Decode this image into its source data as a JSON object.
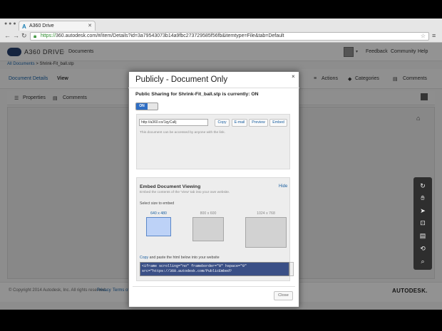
{
  "browser": {
    "tab_title": "A360 Drive",
    "tab_icon": "autodesk-a",
    "url_scheme": "https://",
    "url_rest": "360.autodesk.com/#/item/Details?id=3a79543073b14a9fbc273729585f56fb&itemtype=File&tab=Default"
  },
  "app": {
    "brand": "A360 DRIVE",
    "section": "Documents",
    "feedback": "Feedback",
    "community": "Community",
    "help": "Help",
    "breadcrumb_root": "All Documents",
    "breadcrumb_sep": ">",
    "breadcrumb_current": "Shrink-Fit_ball.stp",
    "subnav": {
      "details": "Document Details",
      "view": "View"
    },
    "actions": "Actions",
    "categories": "Categories",
    "comments": "Comments",
    "panel_tabs": {
      "properties": "Properties",
      "comments": "Comments"
    },
    "footer": {
      "copyright": "© Copyright 2014 Autodesk, Inc. All rights reserved.",
      "privacy": "Privacy",
      "terms": "Terms of",
      "autodesk": "AUTODESK."
    }
  },
  "modal": {
    "title": "Publicly - Document Only",
    "close_glyph": "×",
    "sharing_status": "Public Sharing for Shrink-Fit_ball.stp is currently: ON",
    "toggle_label": "ON",
    "share_link": "http://a360.co/1qyCallj",
    "buttons": {
      "copy": "Copy",
      "email": "E-mail",
      "preview": "Preview",
      "embed": "Embed"
    },
    "access_note": "This document can be accessed by anyone with the link.",
    "embed_title": "Embed Document Viewing",
    "hide": "Hide",
    "embed_desc": "Embed the contents of the 'View' tab into your own website.",
    "select_size": "Select size to embed",
    "sizes": [
      {
        "label": "640 x 480",
        "selected": true
      },
      {
        "label": "800 x 600",
        "selected": false
      },
      {
        "label": "1024 x 768",
        "selected": false
      }
    ],
    "copy_word": "Copy",
    "copy_rest": " and paste the html below into your website",
    "embed_code_line1": "<iframe scrolling=\"no\" frameborder=\"0\" hspace=\"0\"",
    "embed_code_line2": "src=\"https://360.autodesk.com/PublicEmbed?",
    "close_button": "Close"
  },
  "tools": [
    "refresh-icon",
    "pan-hand-icon",
    "select-arrow-icon",
    "zoom-window-icon",
    "comment-icon",
    "zoom-back-icon",
    "zoom-icon"
  ],
  "colors": {
    "accent": "#2f6ec4",
    "link": "#1a5fa0",
    "code_bg": "#3a4f86"
  }
}
